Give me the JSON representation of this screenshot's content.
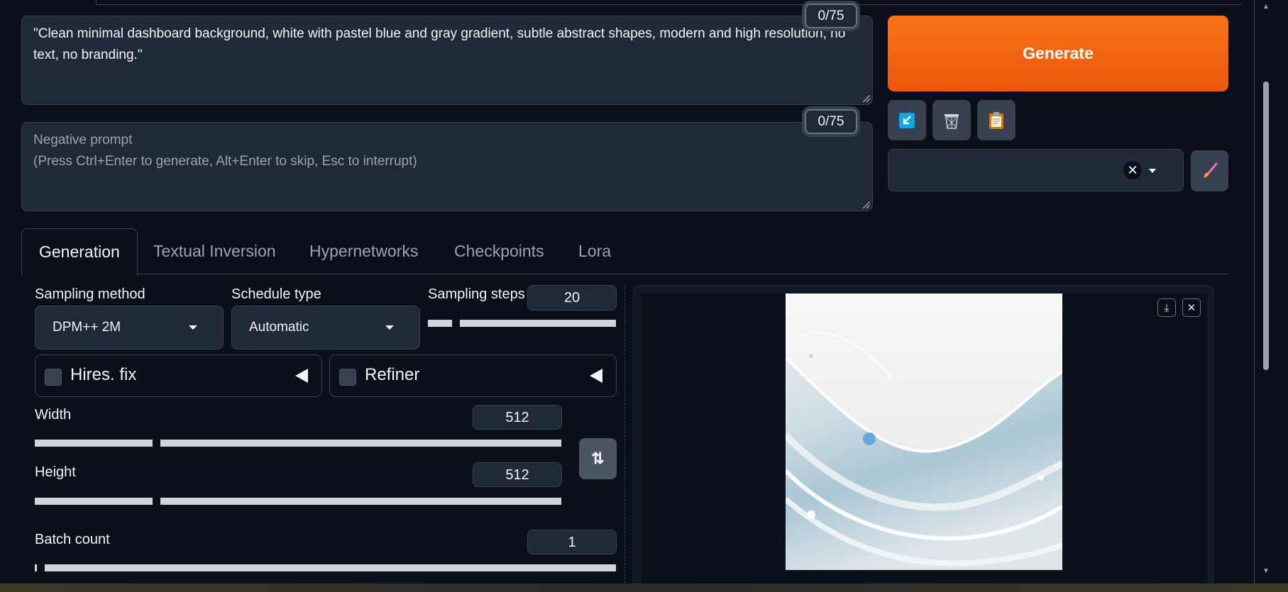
{
  "prompt": {
    "value": "\"Clean minimal dashboard background, white with pastel blue and gray gradient, subtle abstract shapes, modern and high resolution, no text, no branding.\"",
    "counter": "0/75"
  },
  "negative_prompt": {
    "placeholder_line1": "Negative prompt",
    "placeholder_line2": "(Press Ctrl+Enter to generate, Alt+Enter to skip, Esc to interrupt)",
    "counter": "0/75"
  },
  "generate_label": "Generate",
  "tools": [
    "read-params-icon",
    "trash-icon",
    "clipboard-icon"
  ],
  "style_select": {
    "value": "",
    "icons": [
      "clear-icon",
      "chevron-down-icon"
    ]
  },
  "tabs": [
    {
      "label": "Generation",
      "active": true
    },
    {
      "label": "Textual Inversion",
      "active": false
    },
    {
      "label": "Hypernetworks",
      "active": false
    },
    {
      "label": "Checkpoints",
      "active": false
    },
    {
      "label": "Lora",
      "active": false
    }
  ],
  "sampling_method": {
    "label": "Sampling method",
    "value": "DPM++ 2M"
  },
  "schedule_type": {
    "label": "Schedule type",
    "value": "Automatic"
  },
  "sampling_steps": {
    "label": "Sampling steps",
    "value": "20"
  },
  "hires_fix": {
    "label": "Hires. fix",
    "checked": false
  },
  "refiner": {
    "label": "Refiner",
    "checked": false
  },
  "width": {
    "label": "Width",
    "value": "512"
  },
  "height": {
    "label": "Height",
    "value": "512"
  },
  "batch_count": {
    "label": "Batch count",
    "value": "1"
  },
  "gallery_buttons": [
    "download-icon",
    "close-icon"
  ],
  "colors": {
    "accent": "#f97316",
    "background": "#0b0f19",
    "panel": "#1f2937"
  }
}
